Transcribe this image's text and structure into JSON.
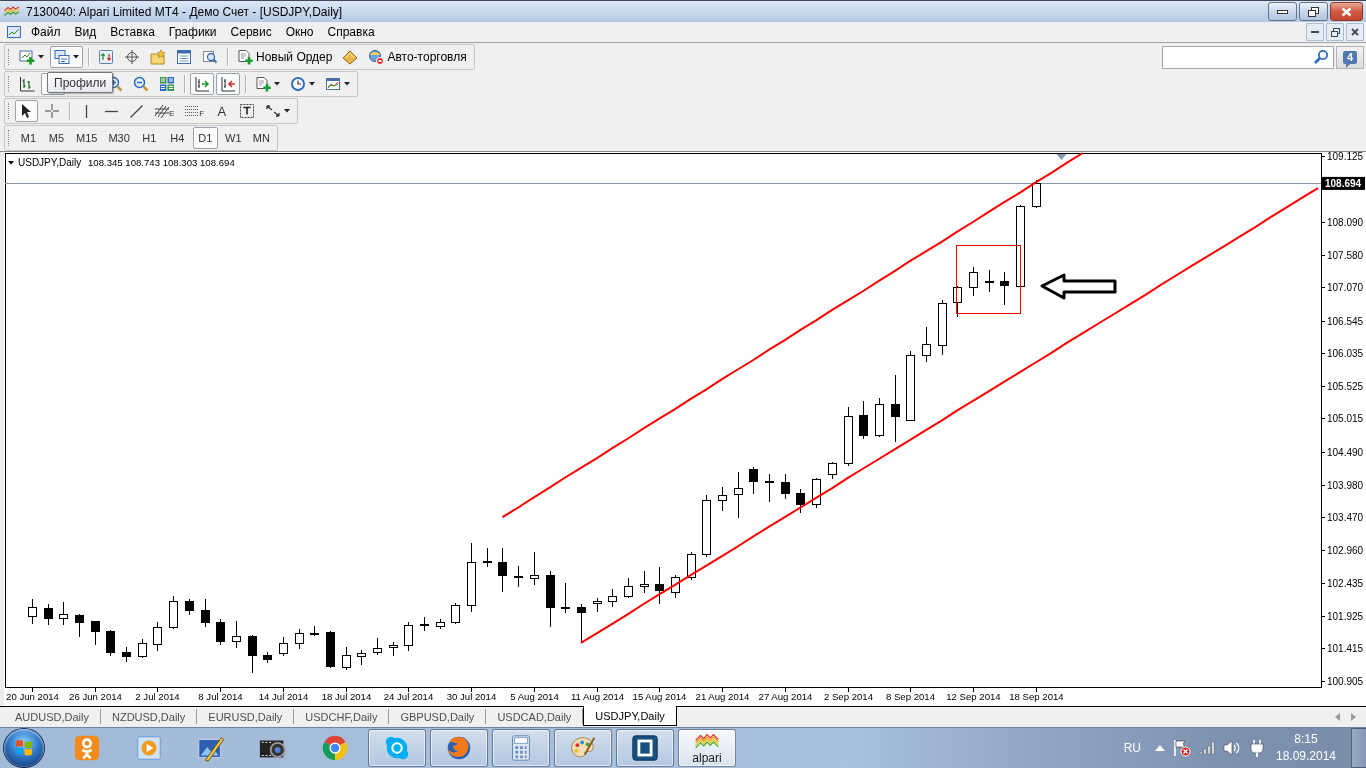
{
  "window": {
    "title": "7130040: Alpari Limited MT4 - Демо Счет - [USDJPY,Daily]"
  },
  "menu": [
    "Файл",
    "Вид",
    "Вставка",
    "Графики",
    "Сервис",
    "Окно",
    "Справка"
  ],
  "toolbars": [
    {
      "groups": [
        [
          {
            "kind": "new-chart",
            "dropdown": true,
            "pressed": false
          },
          {
            "kind": "profiles",
            "dropdown": true,
            "pressed": true
          }
        ],
        [
          {
            "kind": "market-watch",
            "dropdown": false,
            "pressed": false
          },
          {
            "kind": "data-window",
            "dropdown": false,
            "pressed": false
          },
          {
            "kind": "navigator",
            "dropdown": false,
            "pressed": false
          },
          {
            "kind": "terminal",
            "dropdown": false,
            "pressed": false
          },
          {
            "kind": "tester",
            "dropdown": false,
            "pressed": false
          }
        ],
        [
          {
            "kind": "new-order",
            "label": "Новый Ордер",
            "dropdown": false,
            "pressed": false
          },
          {
            "kind": "editor",
            "dropdown": false,
            "pressed": false
          },
          {
            "kind": "auto-trading",
            "label": "Авто-торговля",
            "dropdown": false,
            "pressed": false
          }
        ]
      ]
    },
    {
      "groups": [
        [
          {
            "kind": "bars",
            "dropdown": false,
            "pressed": false
          },
          {
            "kind": "candles",
            "dropdown": false,
            "pressed": true
          },
          {
            "kind": "zoom-in",
            "dropdown": false,
            "pressed": false
          },
          {
            "kind": "zoom-out",
            "dropdown": false,
            "pressed": false
          },
          {
            "kind": "tile",
            "dropdown": false,
            "pressed": false
          }
        ],
        [
          {
            "kind": "auto-scroll",
            "dropdown": false,
            "pressed": true
          },
          {
            "kind": "chart-shift",
            "dropdown": false,
            "pressed": true
          }
        ],
        [
          {
            "kind": "indicators",
            "dropdown": true,
            "pressed": false
          },
          {
            "kind": "periods",
            "dropdown": true,
            "pressed": false
          },
          {
            "kind": "templates",
            "dropdown": true,
            "pressed": false
          }
        ]
      ]
    },
    {
      "groups": [
        [
          {
            "kind": "cursor",
            "dropdown": false,
            "pressed": true
          },
          {
            "kind": "crosshair",
            "dropdown": false,
            "pressed": false
          }
        ],
        [
          {
            "kind": "vline",
            "dropdown": false,
            "pressed": false
          },
          {
            "kind": "hline",
            "dropdown": false,
            "pressed": false
          },
          {
            "kind": "trendline",
            "dropdown": false,
            "pressed": false
          },
          {
            "kind": "fibo-fan",
            "glyph": "E",
            "dropdown": false,
            "pressed": false
          },
          {
            "kind": "fibo-grid",
            "glyph": "F",
            "dropdown": false,
            "pressed": false
          },
          {
            "kind": "text",
            "glyph": "A",
            "dropdown": false,
            "pressed": false
          },
          {
            "kind": "text-label",
            "dropdown": false,
            "pressed": false
          },
          {
            "kind": "arrows",
            "dropdown": true,
            "pressed": false
          }
        ]
      ]
    }
  ],
  "tooltip": {
    "text": "Профили"
  },
  "messages": {
    "count": "4"
  },
  "timeframes": [
    {
      "label": "M1",
      "selected": false
    },
    {
      "label": "M5",
      "selected": false
    },
    {
      "label": "M15",
      "selected": false
    },
    {
      "label": "M30",
      "selected": false
    },
    {
      "label": "H1",
      "selected": false
    },
    {
      "label": "H4",
      "selected": false
    },
    {
      "label": "D1",
      "selected": true
    },
    {
      "label": "W1",
      "selected": false
    },
    {
      "label": "MN",
      "selected": false
    }
  ],
  "chart": {
    "chart_data": [
      {
        "type": "candlestick",
        "title": "USDJPY,Daily",
        "subtitle": "108.345 108.743 108.303 108.694",
        "categories": [
          "20 Jun 2014",
          null,
          null,
          null,
          "26 Jun 2014",
          null,
          null,
          null,
          "2 Jul 2014",
          null,
          null,
          null,
          "8 Jul 2014",
          null,
          null,
          null,
          "14 Jul 2014",
          null,
          null,
          null,
          "18 Jul 2014",
          null,
          null,
          null,
          "24 Jul 2014",
          null,
          null,
          null,
          "30 Jul 2014",
          null,
          null,
          null,
          "5 Aug 2014",
          null,
          null,
          null,
          "11 Aug 2014",
          null,
          null,
          null,
          "15 Aug 2014",
          null,
          null,
          null,
          "21 Aug 2014",
          null,
          null,
          null,
          "27 Aug 2014",
          null,
          null,
          null,
          "2 Sep 2014",
          null,
          null,
          null,
          "8 Sep 2014",
          null,
          null,
          null,
          "12 Sep 2014",
          null,
          null,
          null,
          "18 Sep 2014",
          null,
          null,
          null,
          null,
          null,
          null,
          null,
          null,
          null,
          null,
          null,
          null,
          null,
          null,
          null,
          null,
          null,
          null
        ],
        "ohlc": [
          [
            101.92,
            102.18,
            101.79,
            102.06
          ],
          [
            102.05,
            102.11,
            101.78,
            101.89
          ],
          [
            101.89,
            102.14,
            101.78,
            101.95
          ],
          [
            101.94,
            101.95,
            101.6,
            101.83
          ],
          [
            101.84,
            101.85,
            101.46,
            101.69
          ],
          [
            101.69,
            101.71,
            101.29,
            101.36
          ],
          [
            101.36,
            101.44,
            101.2,
            101.3
          ],
          [
            101.3,
            101.56,
            101.26,
            101.5
          ],
          [
            101.48,
            101.82,
            101.37,
            101.75
          ],
          [
            101.75,
            102.24,
            101.72,
            102.16
          ],
          [
            102.16,
            102.19,
            101.94,
            102.02
          ],
          [
            102.02,
            102.18,
            101.75,
            101.83
          ],
          [
            101.83,
            101.88,
            101.46,
            101.53
          ],
          [
            101.53,
            101.84,
            101.42,
            101.61
          ],
          [
            101.61,
            101.63,
            101.03,
            101.31
          ],
          [
            101.31,
            101.36,
            101.19,
            101.25
          ],
          [
            101.35,
            101.6,
            101.29,
            101.5
          ],
          [
            101.5,
            101.72,
            101.41,
            101.65
          ],
          [
            101.66,
            101.77,
            101.61,
            101.65
          ],
          [
            101.67,
            101.68,
            101.11,
            101.14
          ],
          [
            101.12,
            101.43,
            101.07,
            101.31
          ],
          [
            101.29,
            101.39,
            101.16,
            101.35
          ],
          [
            101.36,
            101.58,
            101.31,
            101.42
          ],
          [
            101.43,
            101.52,
            101.29,
            101.46
          ],
          [
            101.46,
            101.83,
            101.37,
            101.78
          ],
          [
            101.79,
            101.91,
            101.69,
            101.8
          ],
          [
            101.77,
            101.88,
            101.72,
            101.83
          ],
          [
            101.83,
            102.13,
            101.8,
            102.09
          ],
          [
            102.09,
            103.07,
            101.99,
            102.77
          ],
          [
            102.77,
            102.99,
            102.69,
            102.79
          ],
          [
            102.77,
            102.99,
            102.3,
            102.57
          ],
          [
            102.55,
            102.71,
            102.37,
            102.54
          ],
          [
            102.52,
            102.92,
            102.41,
            102.57
          ],
          [
            102.57,
            102.62,
            101.75,
            102.06
          ],
          [
            102.07,
            102.44,
            101.97,
            102.06
          ],
          [
            102.06,
            102.11,
            101.5,
            101.99
          ],
          [
            102.12,
            102.21,
            101.99,
            102.16
          ],
          [
            102.16,
            102.35,
            102.06,
            102.24
          ],
          [
            102.23,
            102.52,
            102.2,
            102.39
          ],
          [
            102.39,
            102.63,
            102.28,
            102.43
          ],
          [
            102.43,
            102.69,
            102.11,
            102.33
          ],
          [
            102.3,
            102.56,
            102.21,
            102.53
          ],
          [
            102.53,
            102.92,
            102.48,
            102.89
          ],
          [
            102.89,
            103.81,
            102.85,
            103.73
          ],
          [
            103.73,
            103.94,
            103.57,
            103.82
          ],
          [
            103.83,
            104.17,
            103.46,
            103.92
          ],
          [
            104.23,
            104.25,
            103.83,
            104.03
          ],
          [
            104.04,
            104.15,
            103.71,
            104.03
          ],
          [
            104.02,
            104.14,
            103.75,
            103.84
          ],
          [
            103.85,
            103.91,
            103.53,
            103.68
          ],
          [
            103.68,
            104.08,
            103.62,
            104.06
          ],
          [
            104.15,
            104.33,
            104.07,
            104.32
          ],
          [
            104.32,
            105.19,
            104.27,
            105.06
          ],
          [
            105.07,
            105.29,
            104.7,
            104.75
          ],
          [
            104.75,
            105.33,
            104.72,
            105.24
          ],
          [
            105.24,
            105.69,
            104.64,
            105.05
          ],
          [
            104.99,
            106.07,
            104.97,
            106.01
          ],
          [
            106.01,
            106.45,
            105.9,
            106.18
          ],
          [
            106.16,
            106.87,
            106.01,
            106.82
          ],
          [
            106.83,
            107.09,
            106.61,
            107.08
          ],
          [
            107.08,
            107.39,
            106.93,
            107.31
          ],
          [
            107.17,
            107.34,
            106.99,
            107.16
          ],
          [
            107.16,
            107.3,
            106.79,
            107.1
          ],
          [
            107.09,
            108.36,
            107.08,
            108.34
          ],
          [
            108.345,
            108.743,
            108.303,
            108.694
          ],
          null,
          null,
          null,
          null,
          null,
          null,
          null,
          null,
          null,
          null,
          null,
          null,
          null,
          null,
          null,
          null,
          null,
          null
        ],
        "series": [
          {
            "type": "line",
            "color": "#ff0000",
            "values": [
              null,
              null,
              null,
              null,
              null,
              null,
              null,
              null,
              null,
              null,
              null,
              null,
              null,
              null,
              null,
              null,
              null,
              null,
              null,
              null,
              null,
              null,
              null,
              null,
              null,
              null,
              null,
              null,
              null,
              null,
              103.47,
              103.62,
              103.78,
              103.93,
              104.09,
              104.24,
              104.39,
              104.55,
              104.7,
              104.86,
              105.01,
              105.16,
              105.32,
              105.47,
              105.63,
              105.78,
              105.93,
              106.09,
              106.24,
              106.4,
              106.55,
              106.71,
              106.86,
              107.01,
              107.17,
              107.32,
              107.48,
              107.63,
              107.78,
              107.94,
              108.09,
              108.25,
              108.4,
              108.55,
              108.71,
              108.86,
              109.02,
              109.17,
              null,
              null,
              null,
              null,
              null,
              null,
              null,
              null,
              null,
              null,
              null,
              null,
              null,
              null,
              null
            ]
          },
          {
            "type": "line",
            "color": "#ff0000",
            "values": [
              null,
              null,
              null,
              null,
              null,
              null,
              null,
              null,
              null,
              null,
              null,
              null,
              null,
              null,
              null,
              null,
              null,
              null,
              null,
              null,
              null,
              null,
              null,
              null,
              null,
              null,
              null,
              null,
              null,
              null,
              null,
              null,
              null,
              null,
              null,
              101.5,
              101.65,
              101.8,
              101.95,
              102.11,
              102.26,
              102.41,
              102.56,
              102.71,
              102.86,
              103.01,
              103.17,
              103.32,
              103.47,
              103.62,
              103.77,
              103.92,
              104.08,
              104.23,
              104.38,
              104.53,
              104.68,
              104.83,
              104.98,
              105.14,
              105.29,
              105.44,
              105.59,
              105.74,
              105.89,
              106.04,
              106.2,
              106.35,
              106.5,
              106.65,
              106.8,
              106.95,
              107.11,
              107.26,
              107.41,
              107.56,
              107.71,
              107.86,
              108.01,
              108.17,
              108.32,
              108.47,
              108.62
            ]
          }
        ],
        "ylim": [
          100.81,
          109.17
        ],
        "yticks": [
          {
            "value": 109.125,
            "label": "109.125"
          },
          {
            "value": 108.09,
            "label": "108.090"
          },
          {
            "value": 107.58,
            "label": "107.580"
          },
          {
            "value": 107.07,
            "label": "107.070"
          },
          {
            "value": 106.545,
            "label": "106.545"
          },
          {
            "value": 106.035,
            "label": "106.035"
          },
          {
            "value": 105.525,
            "label": "105.525"
          },
          {
            "value": 105.015,
            "label": "105.015"
          },
          {
            "value": 104.49,
            "label": "104.490"
          },
          {
            "value": 103.98,
            "label": "103.980"
          },
          {
            "value": 103.47,
            "label": "103.470"
          },
          {
            "value": 102.96,
            "label": "102.960"
          },
          {
            "value": 102.435,
            "label": "102.435"
          },
          {
            "value": 101.925,
            "label": "101.925"
          },
          {
            "value": 101.415,
            "label": "101.415"
          },
          {
            "value": 100.905,
            "label": "100.905"
          }
        ],
        "ref_lines": [
          {
            "axis": "y",
            "value": 108.694,
            "label": "108.694",
            "color": "#8796ab"
          }
        ]
      }
    ]
  },
  "chart_tabs": [
    {
      "label": "AUDUSD,Daily",
      "selected": false
    },
    {
      "label": "NZDUSD,Daily",
      "selected": false
    },
    {
      "label": "EURUSD,Daily",
      "selected": false
    },
    {
      "label": "USDCHF,Daily",
      "selected": false
    },
    {
      "label": "GBPUSD,Daily",
      "selected": false
    },
    {
      "label": "USDCAD,Daily",
      "selected": false
    },
    {
      "label": "USDJPY,Daily",
      "selected": true
    }
  ],
  "taskbar": {
    "apps": [
      {
        "kind": "person",
        "running": false,
        "active": false
      },
      {
        "kind": "player",
        "running": false,
        "active": false
      },
      {
        "kind": "editor",
        "running": false,
        "active": false
      },
      {
        "kind": "camera",
        "running": false,
        "active": false
      },
      {
        "kind": "browser",
        "running": false,
        "active": false
      },
      {
        "kind": "chat",
        "running": true,
        "active": false
      },
      {
        "kind": "globe",
        "running": true,
        "active": false
      },
      {
        "kind": "calculator",
        "running": true,
        "active": false
      },
      {
        "kind": "palette",
        "running": true,
        "active": false
      },
      {
        "kind": "square",
        "running": true,
        "active": false
      },
      {
        "kind": "waves",
        "label": "alpari",
        "running": true,
        "active": true
      }
    ],
    "language": "RU",
    "time": "8:15",
    "date": "18.09.2014"
  }
}
